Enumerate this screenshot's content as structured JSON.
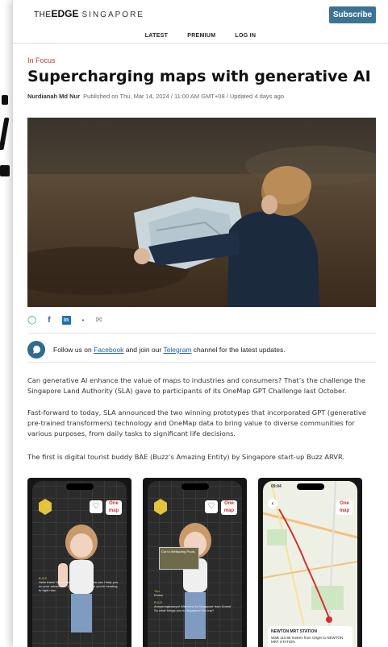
{
  "header": {
    "logo_the": "THE",
    "logo_edge": "EDGE",
    "logo_sg": "SINGAPORE",
    "subscribe_label": "Subscribe"
  },
  "nav": [
    "LATEST",
    "PREMIUM",
    "LOG IN"
  ],
  "article": {
    "kicker": "In Focus",
    "headline": "Supercharging maps with generative AI",
    "author": "Nurdianah Md Nur",
    "published": "Published on Thu, Mar 14, 2024 / 11:00 AM GMT+08 / Updated 4 days ago"
  },
  "share_icons": [
    "whatsapp-icon",
    "facebook-icon",
    "linkedin-icon",
    "dot-icon",
    "email-icon"
  ],
  "follow": {
    "prefix": "Follow us on ",
    "facebook": "Facebook",
    "middle": " and join our ",
    "telegram": "Telegram",
    "suffix": " channel for the latest updates."
  },
  "paragraphs": [
    "Can generative AI enhance the value of maps to industries and consumers? That’s the challenge the Singapore Land Authority (SLA) gave to participants of its OneMap GPT Challenge last October.",
    "Fast-forward to today, SLA announced the two winning prototypes that incorporated GPT (generative pre-trained transformers) technology and OneMap data to bring value to diverse communities for various purposes, from daily tasks to significant life decisions.",
    "The first is digital tourist buddy BAE (Buzz’s Amazing Entity) by Singapore start-up Buzz ARVR."
  ],
  "phones": {
    "p1_name": "B.A.E.",
    "p1_msg": "Hello there! Welcome to Singapore. How can I help you on your adventure? Let me know where you're heading to right now.",
    "p2_caption": "Cut to Wellspring Pools",
    "p2_you": "You",
    "p2_you_msg": "Korea",
    "p2_name": "B.A.E.",
    "p2_msg": "Annyeonghaseyo! Welcome to Singapore from Korea! So what brings you to Singapore this trip?",
    "p3_time": "09:04",
    "p3_station": "NEWTON MRT STATION",
    "p3_detail": "Walk 110.85 metres from Origin to NEWTON MRT STATION",
    "onemap": "One map"
  }
}
